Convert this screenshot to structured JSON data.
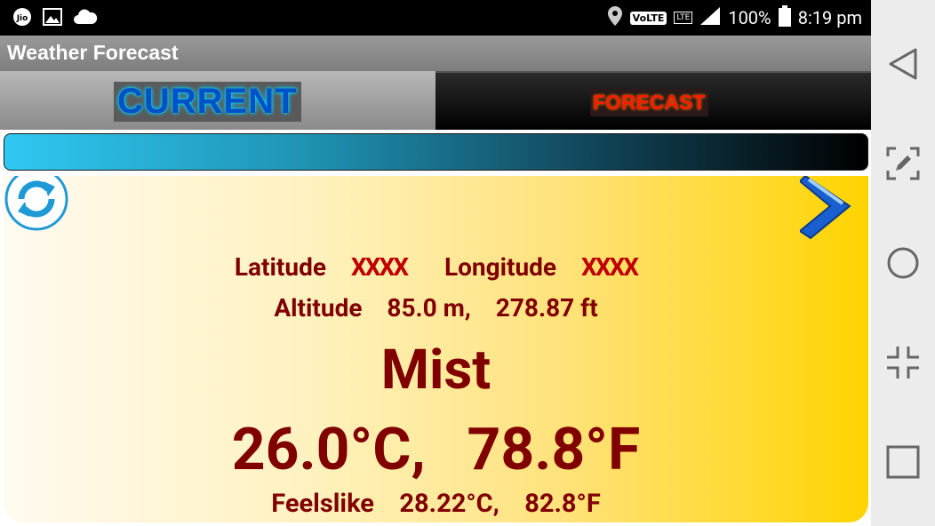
{
  "status_bar": {
    "left_icons": [
      "jio-icon",
      "image-icon",
      "cloud-icon"
    ],
    "volte": "VoLTE",
    "lte": "LTE",
    "battery": "100%",
    "time": "8:19 pm"
  },
  "app": {
    "title": "Weather Forecast"
  },
  "tabs": [
    {
      "label": "CURRENT",
      "selected": true
    },
    {
      "label": "FORECAST",
      "selected": false
    }
  ],
  "weather": {
    "latitude_label": "Latitude",
    "latitude_value": "XXXX",
    "longitude_label": "Longitude",
    "longitude_value": "XXXX",
    "altitude_label": "Altitude",
    "altitude_m": "85.0 m,",
    "altitude_ft": "278.87 ft",
    "condition": "Mist",
    "temp_c": "26.0°C,",
    "temp_f": "78.8°F",
    "feels_label": "Feelslike",
    "feels_c": "28.22°C,",
    "feels_f": "82.8°F"
  },
  "nav_bar": [
    "back-icon",
    "screenshot-edit-icon",
    "home-icon",
    "minimize-icon",
    "recents-icon"
  ]
}
